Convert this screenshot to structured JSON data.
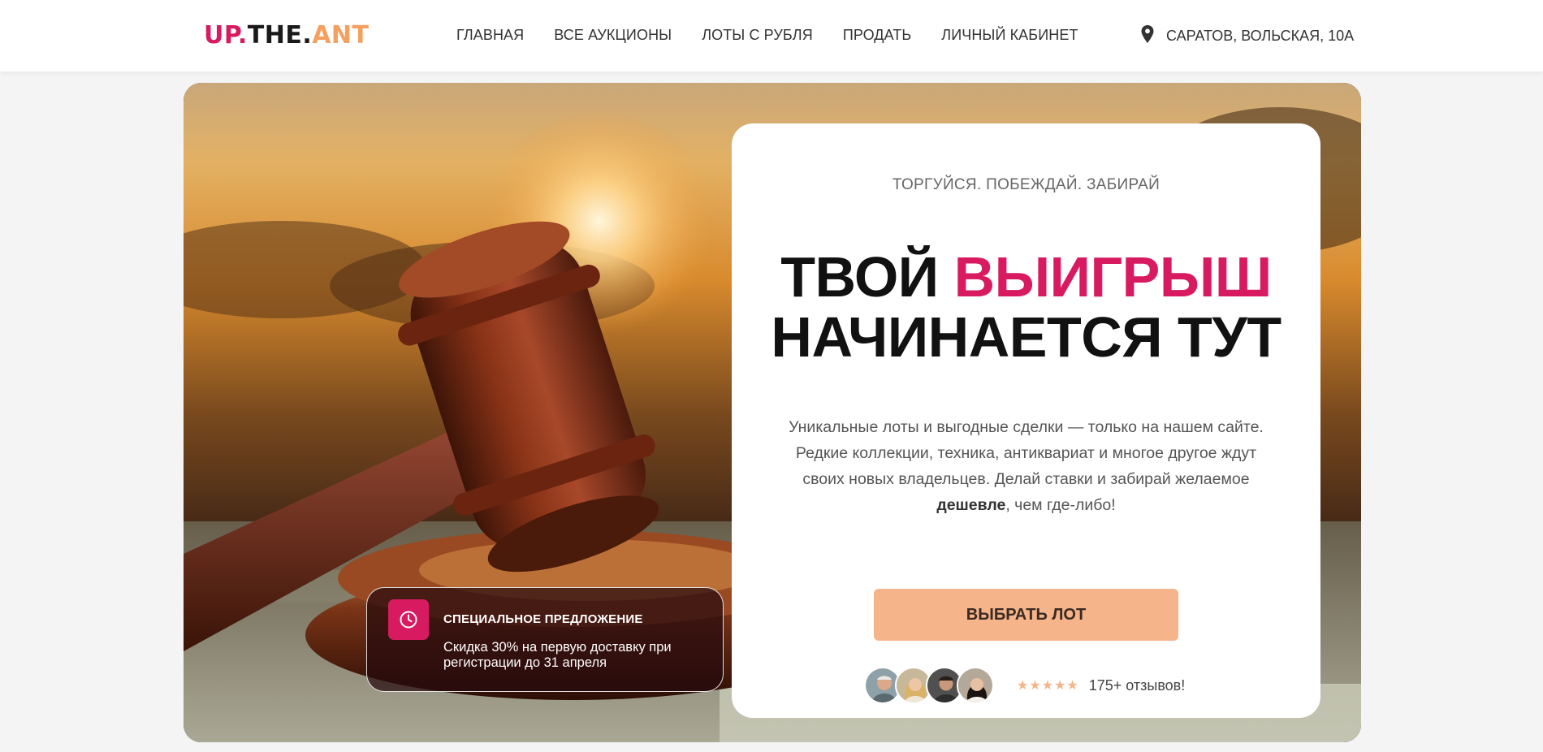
{
  "header": {
    "logo_part1": "UP.",
    "logo_part2": "THE.",
    "logo_part3": "ANT",
    "nav": [
      "ГЛАВНАЯ",
      "ВСЕ АУКЦИОНЫ",
      "ЛОТЫ С РУБЛЯ",
      "ПРОДАТЬ",
      "ЛИЧНЫЙ КАБИНЕТ"
    ],
    "address": "САРАТОВ, ВОЛЬСКАЯ, 10А"
  },
  "hero": {
    "offer": {
      "title": "СПЕЦИАЛЬНОЕ ПРЕДЛОЖЕНИЕ",
      "text": "Скидка 30% на первую доставку при регистрации до 31 апреля"
    },
    "tagline": "ТОРГУЙСЯ. ПОБЕЖДАЙ. ЗАБИРАЙ",
    "headline_word1": "ТВОЙ",
    "headline_accent": "ВЫИГРЫШ",
    "headline_line2": "НАЧИНАЕТСЯ ТУТ",
    "desc_main": "Уникальные лоты и выгодные сделки — только на нашем сайте. Редкие коллекции, техника, антиквариат и многое другое ждут своих новых владельцев. Делай ставки и забирай желаемое",
    "desc_bold": "дешевле",
    "desc_end": ", чем где-либо!",
    "cta_label": "ВЫБРАТЬ ЛОТ",
    "stars": "★★★★★",
    "rating": 5,
    "review_count": "175+ отзывов!"
  },
  "colors": {
    "accent": "#d81b60",
    "orange": "#f5a05f",
    "cta": "#f5b489"
  },
  "icons": [
    "location-pin-icon",
    "clock-icon",
    "star-icon"
  ]
}
